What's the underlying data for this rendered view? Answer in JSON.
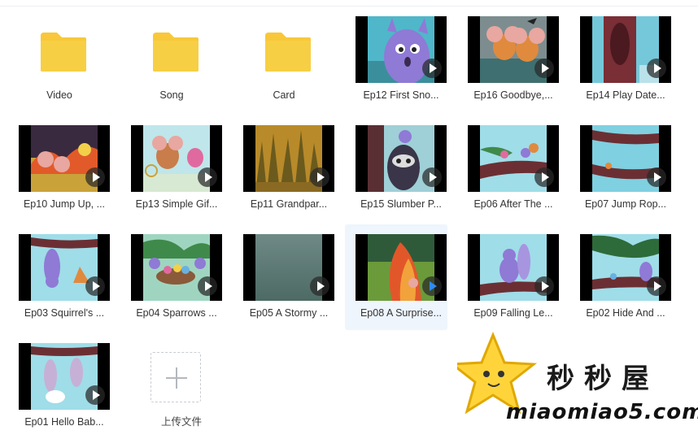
{
  "folders": [
    {
      "label": "Video"
    },
    {
      "label": "Song"
    },
    {
      "label": "Card"
    }
  ],
  "videos": [
    {
      "label": "Ep12 First Sno...",
      "scene": "squirrel-closeup",
      "colors": {
        "bg": "#4fb7c9",
        "main": "#8f7ad6"
      }
    },
    {
      "label": "Ep16 Goodbye,...",
      "scene": "mice-pair",
      "colors": {
        "bg": "#7d8d8f",
        "main": "#e08a3e"
      }
    },
    {
      "label": "Ep14 Play Date...",
      "scene": "tree-trunk",
      "colors": {
        "bg": "#74c8da",
        "main": "#7a2e35"
      }
    },
    {
      "label": "Ep10 Jump Up, ...",
      "scene": "leaves-mice",
      "colors": {
        "bg": "#3a2a3f",
        "main": "#e25a2a"
      }
    },
    {
      "label": "Ep13 Simple Gif...",
      "scene": "mouse-bird",
      "colors": {
        "bg": "#bfe6ea",
        "main": "#c97d4a"
      }
    },
    {
      "label": "Ep11 Grandpar...",
      "scene": "grass",
      "colors": {
        "bg": "#b88a2a",
        "main": "#6b5a1d"
      }
    },
    {
      "label": "Ep15 Slumber P...",
      "scene": "raccoon",
      "colors": {
        "bg": "#9fcfd7",
        "main": "#3a3548"
      }
    },
    {
      "label": "Ep06 After The ...",
      "scene": "branch-birds",
      "colors": {
        "bg": "#9fdde8",
        "main": "#6b2f33"
      }
    },
    {
      "label": "Ep07 Jump Rop...",
      "scene": "branch-rope",
      "colors": {
        "bg": "#7fd0e0",
        "main": "#6b2f33"
      }
    },
    {
      "label": "Ep03 Squirrel's ...",
      "scene": "hanging-squirrel",
      "colors": {
        "bg": "#9fdde8",
        "main": "#8f7ad6"
      }
    },
    {
      "label": "Ep04 Sparrows ...",
      "scene": "nest",
      "colors": {
        "bg": "#9fd5c0",
        "main": "#8a5a3a"
      }
    },
    {
      "label": "Ep05 A Stormy ...",
      "scene": "stormy",
      "colors": {
        "bg": "#5d7a74",
        "main": "#4d6a64"
      }
    },
    {
      "label": "Ep08 A Surprise...",
      "scene": "autumn-bush",
      "colors": {
        "bg": "#6b9a3a",
        "main": "#e2572a"
      }
    },
    {
      "label": "Ep09 Falling Le...",
      "scene": "squirrel-branch",
      "colors": {
        "bg": "#9fdde8",
        "main": "#8f7ad6"
      }
    },
    {
      "label": "Ep02 Hide And ...",
      "scene": "branch-leaves",
      "colors": {
        "bg": "#9fdde8",
        "main": "#2e6b3a"
      }
    },
    {
      "label": "Ep01 Hello Bab...",
      "scene": "babies-hanging",
      "colors": {
        "bg": "#9fdde8",
        "main": "#c7b0d6"
      }
    }
  ],
  "upload": {
    "label": "上传文件"
  },
  "watermark": {
    "cn": "秒秒屋",
    "url": "miaomiao5.com"
  },
  "accent": "#2f8bf1",
  "folder_color": "#f8c83a"
}
